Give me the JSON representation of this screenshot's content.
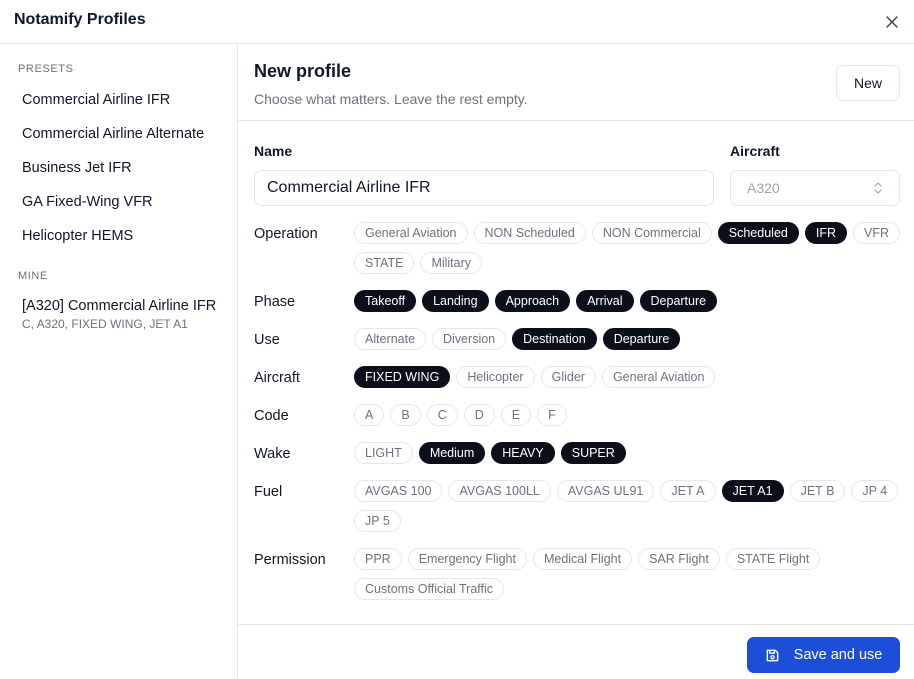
{
  "app": {
    "title": "Notamify Profiles"
  },
  "sidebar": {
    "presets_heading": "PRESETS",
    "presets": [
      "Commercial Airline IFR",
      "Commercial Airline Alternate",
      "Business Jet IFR",
      "GA Fixed-Wing VFR",
      "Helicopter HEMS"
    ],
    "mine_heading": "MINE",
    "mine": [
      {
        "title": "[A320] Commercial Airline IFR",
        "subtitle": "C, A320, FIXED WING, JET A1"
      }
    ]
  },
  "main": {
    "title": "New profile",
    "subtitle": "Choose what matters. Leave the rest empty.",
    "new_button": "New",
    "name_label": "Name",
    "name_value": "Commercial Airline IFR",
    "aircraft_label": "Aircraft",
    "aircraft_value": "A320",
    "save_button": "Save and use"
  },
  "rows": [
    {
      "label": "Operation",
      "chips": [
        {
          "label": "General Aviation",
          "selected": false
        },
        {
          "label": "NON Scheduled",
          "selected": false
        },
        {
          "label": "NON Commercial",
          "selected": false
        },
        {
          "label": "Scheduled",
          "selected": true
        },
        {
          "label": "IFR",
          "selected": true
        },
        {
          "label": "VFR",
          "selected": false
        },
        {
          "label": "STATE",
          "selected": false
        },
        {
          "label": "Military",
          "selected": false
        }
      ]
    },
    {
      "label": "Phase",
      "chips": [
        {
          "label": "Takeoff",
          "selected": true
        },
        {
          "label": "Landing",
          "selected": true
        },
        {
          "label": "Approach",
          "selected": true
        },
        {
          "label": "Arrival",
          "selected": true
        },
        {
          "label": "Departure",
          "selected": true
        }
      ]
    },
    {
      "label": "Use",
      "chips": [
        {
          "label": "Alternate",
          "selected": false
        },
        {
          "label": "Diversion",
          "selected": false
        },
        {
          "label": "Destination",
          "selected": true
        },
        {
          "label": "Departure",
          "selected": true
        }
      ]
    },
    {
      "label": "Aircraft",
      "chips": [
        {
          "label": "FIXED WING",
          "selected": true
        },
        {
          "label": "Helicopter",
          "selected": false
        },
        {
          "label": "Glider",
          "selected": false
        },
        {
          "label": "General Aviation",
          "selected": false
        }
      ]
    },
    {
      "label": "Code",
      "chips": [
        {
          "label": "A",
          "selected": false
        },
        {
          "label": "B",
          "selected": false
        },
        {
          "label": "C",
          "selected": false
        },
        {
          "label": "D",
          "selected": false
        },
        {
          "label": "E",
          "selected": false
        },
        {
          "label": "F",
          "selected": false
        }
      ]
    },
    {
      "label": "Wake",
      "chips": [
        {
          "label": "LIGHT",
          "selected": false
        },
        {
          "label": "Medium",
          "selected": true
        },
        {
          "label": "HEAVY",
          "selected": true
        },
        {
          "label": "SUPER",
          "selected": true
        }
      ]
    },
    {
      "label": "Fuel",
      "chips": [
        {
          "label": "AVGAS 100",
          "selected": false
        },
        {
          "label": "AVGAS 100LL",
          "selected": false
        },
        {
          "label": "AVGAS UL91",
          "selected": false
        },
        {
          "label": "JET A",
          "selected": false
        },
        {
          "label": "JET A1",
          "selected": true
        },
        {
          "label": "JET B",
          "selected": false
        },
        {
          "label": "JP 4",
          "selected": false
        },
        {
          "label": "JP 5",
          "selected": false
        }
      ]
    },
    {
      "label": "Permission",
      "chips": [
        {
          "label": "PPR",
          "selected": false
        },
        {
          "label": "Emergency Flight",
          "selected": false
        },
        {
          "label": "Medical Flight",
          "selected": false
        },
        {
          "label": "SAR Flight",
          "selected": false
        },
        {
          "label": "STATE Flight",
          "selected": false
        },
        {
          "label": "Customs Official Traffic",
          "selected": false
        }
      ]
    }
  ],
  "icons": {
    "close": "close-icon",
    "select": "chevron-up-down-icon",
    "save": "floppy-disk-icon"
  },
  "colors": {
    "accent": "#1d4ed8",
    "chip_selected": "#0b0f1a",
    "border": "#e5e7eb",
    "muted": "#6b7280"
  }
}
